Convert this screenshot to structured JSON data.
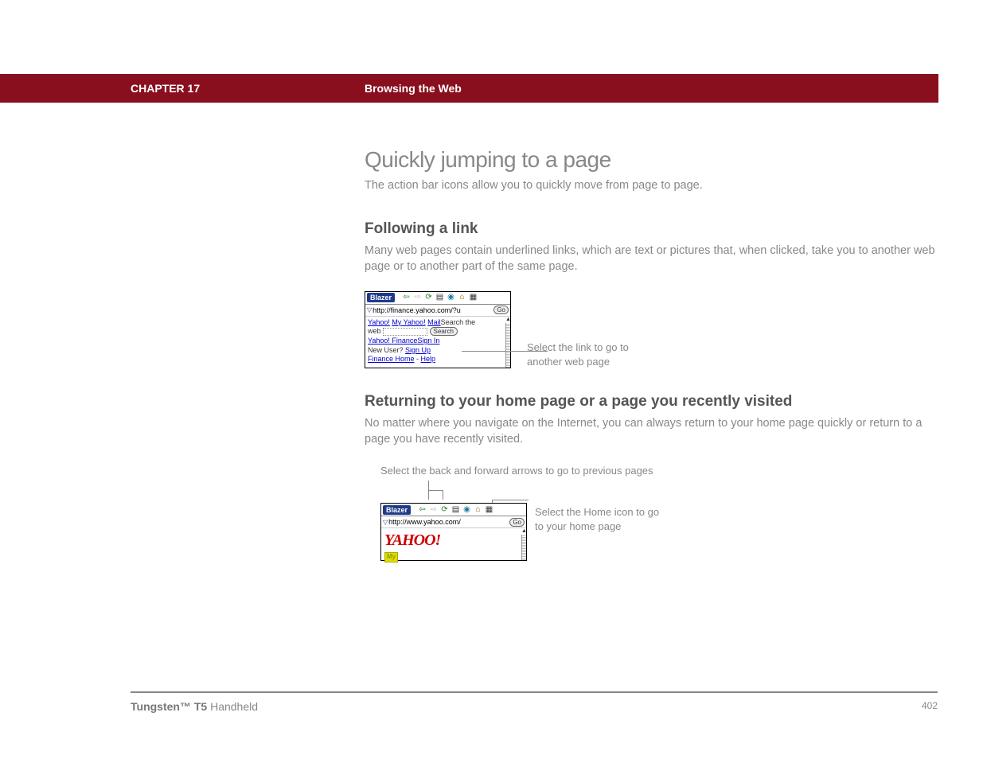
{
  "header": {
    "chapter": "CHAPTER 17",
    "title": "Browsing the Web"
  },
  "main": {
    "h1": "Quickly jumping to a page",
    "intro": "The action bar icons allow you to quickly move from page to page.",
    "section1": {
      "heading": "Following a link",
      "body": "Many web pages contain underlined links, which are text or pictures that, when clicked, take you to another web page or to another part of the same page.",
      "callout": "Select the link to go to another web page",
      "screenshot": {
        "appName": "Blazer",
        "url": "http://finance.yahoo.com/?u",
        "goLabel": "Go",
        "navLinks": {
          "yahoo": "Yahoo!",
          "myYahoo": "My Yahoo!",
          "mail": "Mail"
        },
        "searchLabel": "Search the web",
        "searchBtn": "Search",
        "financeSignIn": "Yahoo! Finance",
        "signInText": "Sign In",
        "newUser": "New User? ",
        "signUp": "Sign Up",
        "financeHome": "Finance Home",
        "dash": " - ",
        "help": "Help"
      }
    },
    "section2": {
      "heading": "Returning to your home page or a page you recently visited",
      "body": "No matter where you navigate on the Internet, you can always return to your home page quickly or return to a page you have recently visited.",
      "calloutTop": "Select the back and forward arrows to go to previous pages",
      "calloutRight": "Select the Home icon to go to your home page",
      "screenshot": {
        "appName": "Blazer",
        "url": "http://www.yahoo.com/",
        "goLabel": "Go",
        "logoText": "YAHOO!",
        "myBadge": "My"
      }
    }
  },
  "footer": {
    "productBold": "Tungsten™ T5",
    "productRest": " Handheld",
    "page": "402"
  }
}
